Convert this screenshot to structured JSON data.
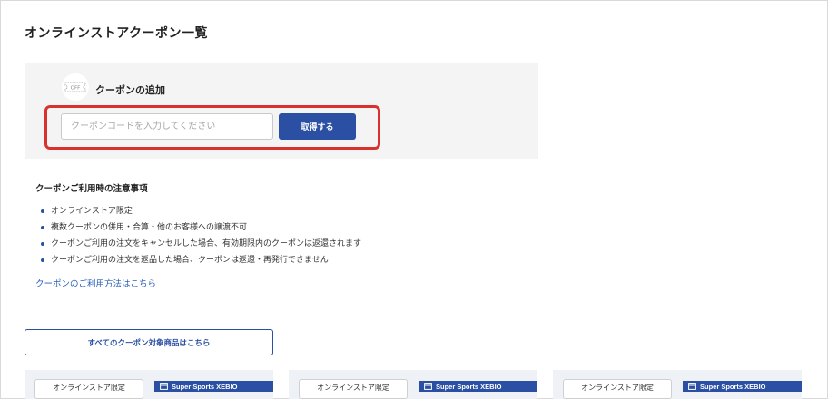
{
  "page": {
    "title": "オンラインストアクーポン一覧"
  },
  "add_coupon": {
    "icon": "coupon-off-ticket-icon",
    "icon_text": "OFF",
    "title": "クーポンの追加",
    "input_placeholder": "クーポンコードを入力してください",
    "input_value": "",
    "submit_label": "取得する",
    "highlight_color": "#d9322e"
  },
  "notes": {
    "title": "クーポンご利用時の注意事項",
    "items": [
      "オンラインストア限定",
      "複数クーポンの併用・合算・他のお客様への譲渡不可",
      "クーポンご利用の注文をキャンセルした場合、有効期限内のクーポンは返還されます",
      "クーポンご利用の注文を返品した場合、クーポンは返還・再発行できません"
    ],
    "usage_link": "クーポンのご利用方法はこちら"
  },
  "all_items_button": "すべてのクーポン対象商品はこちら",
  "coupon_cards": [
    {
      "tag": "オンラインストア限定",
      "brand": "Super Sports XEBIO",
      "brand_icon": "store-icon"
    },
    {
      "tag": "オンラインストア限定",
      "brand": "Super Sports XEBIO",
      "brand_icon": "store-icon"
    },
    {
      "tag": "オンラインストア限定",
      "brand": "Super Sports XEBIO",
      "brand_icon": "store-icon"
    }
  ],
  "colors": {
    "accent": "#2a4fa3",
    "link": "#2a5fb8",
    "panel_bg": "#f4f4f4",
    "card_bg": "#eef1f6"
  }
}
